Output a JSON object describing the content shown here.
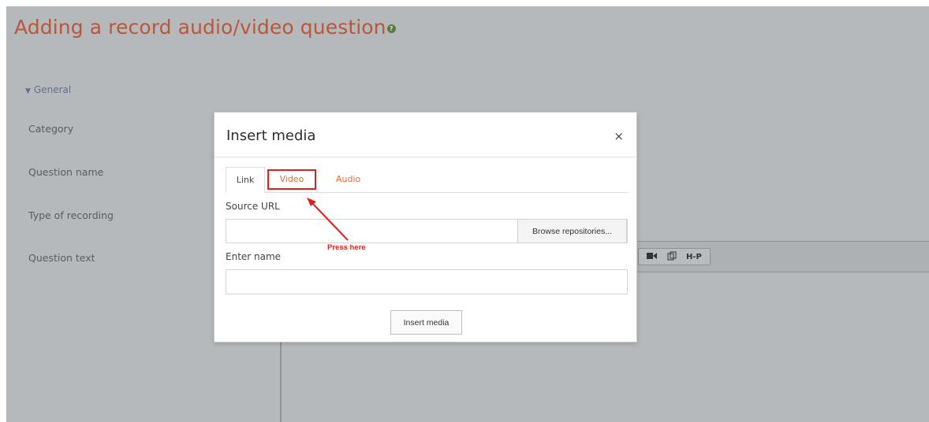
{
  "page": {
    "title": "Adding a record audio/video question",
    "help_icon": "?"
  },
  "form": {
    "section_toggle": "General",
    "labels": {
      "category": "Category",
      "question_name": "Question name",
      "type_of_recording": "Type of recording",
      "question_text": "Question text"
    }
  },
  "editor_toolbar": {
    "icons": [
      "video-icon",
      "copy-icon",
      "h5p-icon"
    ],
    "h5p_label": "H-P"
  },
  "modal": {
    "title": "Insert media",
    "close": "×",
    "tabs": [
      {
        "label": "Link",
        "active": true
      },
      {
        "label": "Video",
        "active": false
      },
      {
        "label": "Audio",
        "active": false
      }
    ],
    "source_url_label": "Source URL",
    "source_url_value": "",
    "browse_button": "Browse repositories...",
    "enter_name_label": "Enter name",
    "enter_name_value": "",
    "insert_button": "Insert media"
  },
  "annotation": {
    "text": "Press here",
    "color": "#e0201a"
  },
  "colors": {
    "title": "#b8573a",
    "tab_accent": "#e5692f",
    "backdrop": "#b6b9bb"
  }
}
